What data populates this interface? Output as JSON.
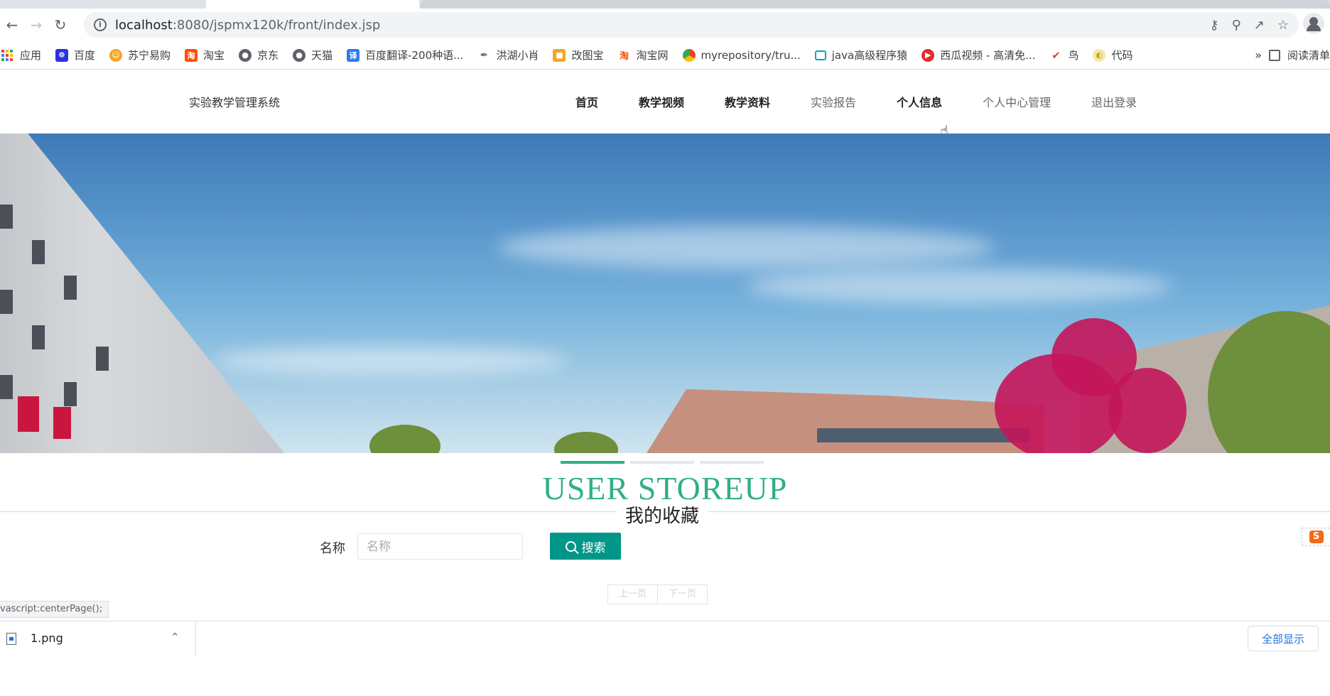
{
  "browser": {
    "url_host": "localhost",
    "url_path": ":8080/jspmx120k/front/index.jsp",
    "bookmarks": [
      {
        "label": "应用",
        "icon": "apps-grid-icon",
        "color": "#4285f4"
      },
      {
        "label": "百度",
        "icon": "baidu-paw-icon",
        "color": "#2932e1"
      },
      {
        "label": "苏宁易购",
        "icon": "suning-icon",
        "color": "#f5a623"
      },
      {
        "label": "淘宝",
        "icon": "taobao-icon",
        "color": "#ff5000"
      },
      {
        "label": "京东",
        "icon": "globe-icon",
        "color": "#5f6368"
      },
      {
        "label": "天猫",
        "icon": "globe-icon",
        "color": "#5f6368"
      },
      {
        "label": "百度翻译-200种语...",
        "icon": "translate-icon",
        "color": "#2c7bf0"
      },
      {
        "label": "洪湖小肖",
        "icon": "feather-icon",
        "color": "#5f6368"
      },
      {
        "label": "改图宝",
        "icon": "gaitubao-icon",
        "color": "#f5a623"
      },
      {
        "label": "淘宝网",
        "icon": "taobao-icon",
        "color": "#ff5000"
      },
      {
        "label": "myrepository/tru...",
        "icon": "chrome-icon",
        "color": "#34a853"
      },
      {
        "label": "java高级程序猿",
        "icon": "bilibili-icon",
        "color": "#00a1d6"
      },
      {
        "label": "西瓜视频 - 高清免...",
        "icon": "xigua-icon",
        "color": "#e02f2f"
      },
      {
        "label": "鸟",
        "icon": "bird-icon",
        "color": "#e8412b"
      },
      {
        "label": "代码",
        "icon": "code-icon",
        "color": "#f0c419"
      }
    ],
    "overflow": "»",
    "reading_list": "阅读清单"
  },
  "site": {
    "brand": "实验教学管理系统",
    "nav": [
      {
        "label": "首页",
        "style": "bold"
      },
      {
        "label": "教学视频",
        "style": "bold"
      },
      {
        "label": "教学资料",
        "style": "bold"
      },
      {
        "label": "实验报告",
        "style": "light"
      },
      {
        "label": "个人信息",
        "style": "bold"
      },
      {
        "label": "个人中心管理",
        "style": "light"
      },
      {
        "label": "退出登录",
        "style": "light"
      }
    ]
  },
  "section": {
    "title_en": "USER STOREUP",
    "title_cn": "我的收藏",
    "accent": "#2fb081"
  },
  "search": {
    "label": "名称",
    "placeholder": "名称",
    "value": "",
    "button_label": "搜索",
    "button_color": "#009688"
  },
  "pager": {
    "prev": "上一页",
    "next": "下一页"
  },
  "status_text": "vascript:centerPage();",
  "downloads": {
    "file_name": "1.png",
    "show_all": "全部显示"
  }
}
